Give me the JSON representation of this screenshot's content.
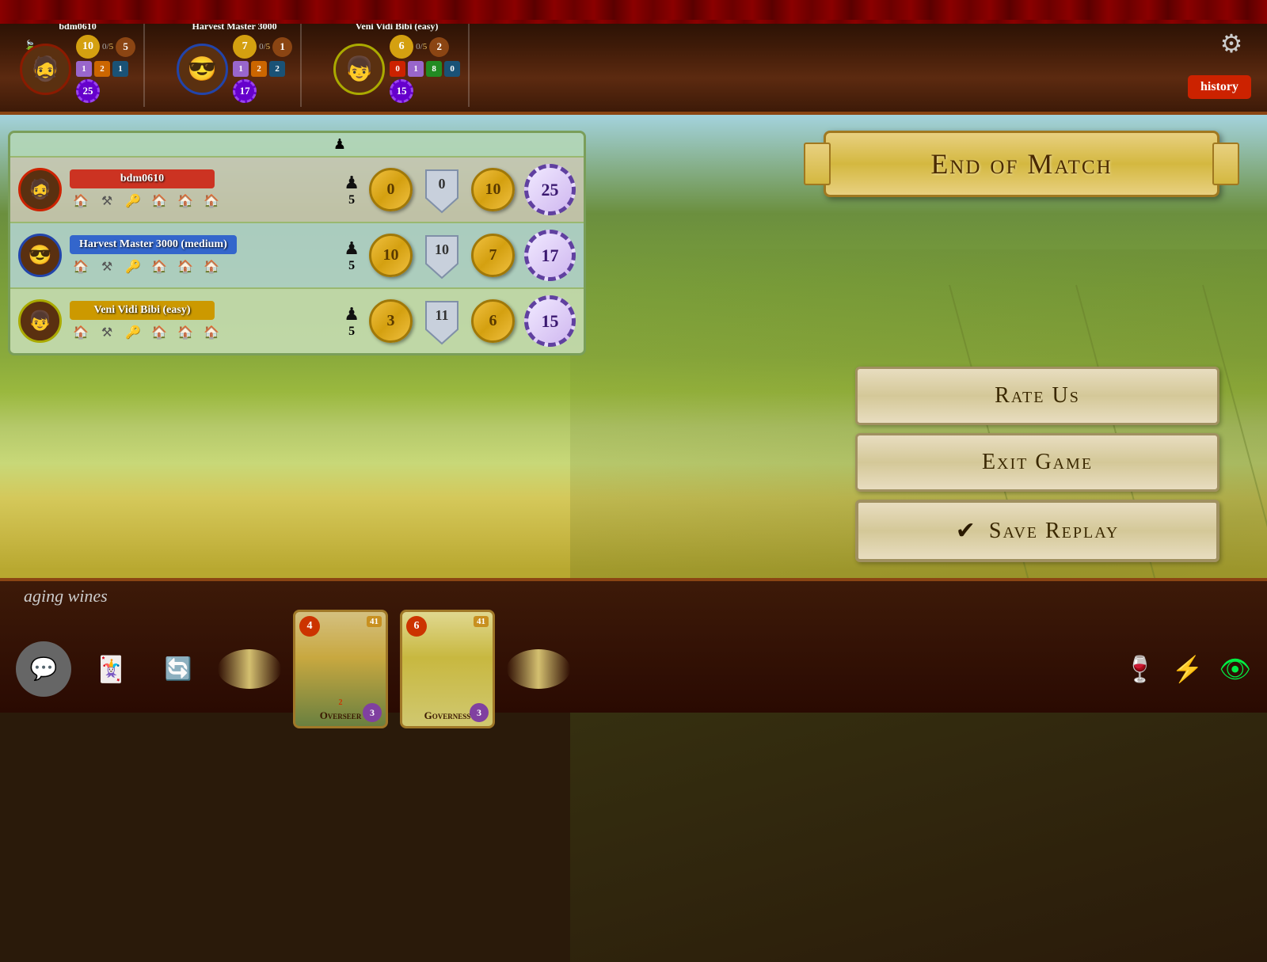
{
  "game": {
    "title": "End of Match",
    "subtitle": "aging wines"
  },
  "players": [
    {
      "id": "p1",
      "name": "bdm0610",
      "avatar": "🧔",
      "color": "red",
      "nameBadgeClass": "name-red",
      "topScore": {
        "coins": 10,
        "slash": "0/5",
        "workers": 5,
        "nums": [
          1,
          2,
          1
        ]
      },
      "topVP": 25,
      "meeples": 5,
      "gold": 0,
      "shield": 0,
      "coins": 10,
      "vp": 25,
      "hasCrown": true
    },
    {
      "id": "p2",
      "name": "Harvest Master 3000",
      "nameDisplay": "Harvest Master 3000 (medium)",
      "avatar": "😎",
      "color": "blue",
      "nameBadgeClass": "name-blue",
      "topScore": {
        "coins": 7,
        "slash": "0/5",
        "workers": 1,
        "nums": [
          1,
          2,
          2
        ]
      },
      "topVP": 17,
      "meeples": 5,
      "gold": 10,
      "shield": 10,
      "coins": 7,
      "vp": 17,
      "hasCrown": false
    },
    {
      "id": "p3",
      "name": "Veni Vidi Bibi",
      "nameDisplay": "Veni Vidi Bibi (easy)",
      "avatar": "👦",
      "color": "yellow",
      "nameBadgeClass": "name-yellow",
      "topScore": {
        "coins": 6,
        "slash": "0/5",
        "workers": 2,
        "nums": [
          0,
          1,
          8,
          0
        ]
      },
      "topVP": 15,
      "meeples": 5,
      "gold": 3,
      "shield": 11,
      "coins": 6,
      "vp": 15,
      "hasCrown": false
    }
  ],
  "scoreTable": {
    "rows": [
      {
        "playerName": "bdm0610",
        "badgeClass": "name-red",
        "meeples": 5,
        "gold1": 0,
        "gold2": 0,
        "coins": 10,
        "vp": 25
      },
      {
        "playerName": "Harvest Master 3000 (medium)",
        "badgeClass": "name-blue",
        "meeples": 5,
        "gold1": 10,
        "gold2": 10,
        "coins": 7,
        "vp": 17
      },
      {
        "playerName": "Veni Vidi Bibi (easy)",
        "badgeClass": "name-yellow",
        "meeples": 5,
        "gold1": 3,
        "gold2": 11,
        "coins": 6,
        "vp": 15
      }
    ]
  },
  "buttons": {
    "rateUs": "Rate Us",
    "exitGame": "Exit Game",
    "saveReplay": "Save Replay",
    "history": "history"
  },
  "bottomBar": {
    "label": "aging wines",
    "cards": [
      {
        "title": "Overseer",
        "cost": 4,
        "costColor": "red",
        "vp": 41,
        "points": 2,
        "bottomVal": 3
      },
      {
        "title": "Governess",
        "cost": 6,
        "costColor": "red",
        "vp": 41,
        "points": "",
        "bottomVal": 3
      }
    ]
  },
  "settings": {
    "icon": "⚙"
  },
  "topScores": [
    {
      "name": "bdm0610",
      "coinsTop": 10,
      "slash": "0/5",
      "workers": 5,
      "extra": [
        1,
        2,
        1
      ],
      "vp": 25,
      "hasCrown": true,
      "checkmark": true
    },
    {
      "name": "Harvest Master 3000",
      "topName": "Harvest Master 3000",
      "coinsTop": 7,
      "slash": "0/5",
      "workers": 1,
      "extra": [
        1,
        2,
        2
      ],
      "vp": 17,
      "hasCrown": false,
      "checkmark": true
    },
    {
      "name": "Veni Vidi Bibi (easy)",
      "topName": "Veni Vidi Bibi (easy)",
      "coinsTop": 6,
      "slash": "0/5",
      "workers": 2,
      "extra": [
        0,
        1,
        8,
        0
      ],
      "vp": 15,
      "hasCrown": false,
      "checkmark": false
    }
  ]
}
